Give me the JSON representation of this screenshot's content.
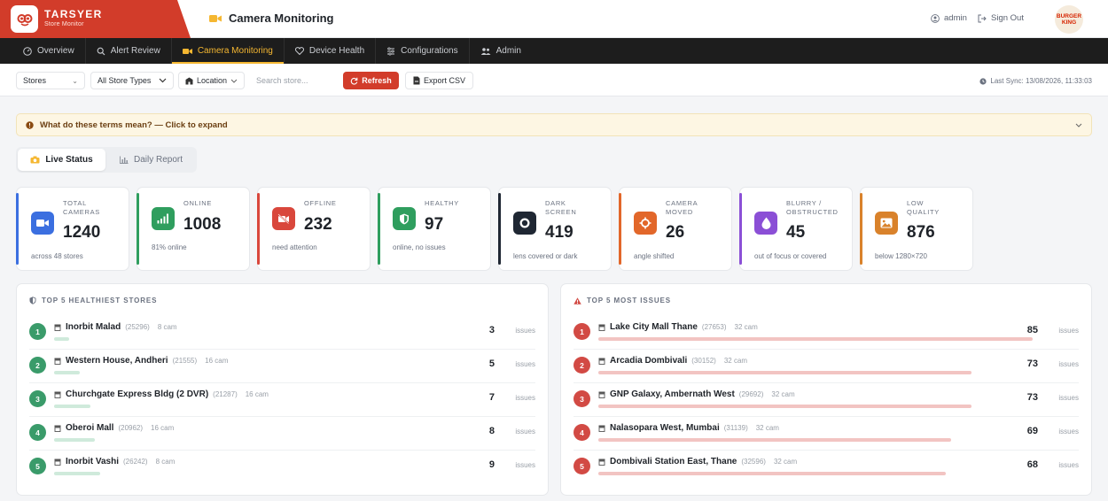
{
  "brand": {
    "name": "TARSYER",
    "subtitle": "Store Monitor"
  },
  "header": {
    "title": "Camera Monitoring",
    "user": "admin",
    "signout": "Sign Out",
    "partner_logo_line1": "BURGER",
    "partner_logo_line2": "KING"
  },
  "nav": [
    {
      "label": "Overview",
      "icon": "dashboard-icon"
    },
    {
      "label": "Alert Review",
      "icon": "search-icon"
    },
    {
      "label": "Camera Monitoring",
      "icon": "video-camera-icon",
      "active": true
    },
    {
      "label": "Device Health",
      "icon": "heart-icon"
    },
    {
      "label": "Configurations",
      "icon": "sliders-icon"
    },
    {
      "label": "Admin",
      "icon": "users-icon"
    }
  ],
  "filters": {
    "stores": "Stores",
    "store_types": "All Store Types",
    "location": "Location",
    "search_placeholder": "Search store...",
    "refresh": "Refresh",
    "export": "Export CSV",
    "last_sync": "Last Sync: 13/08/2026, 11:33:03"
  },
  "glossary": {
    "text": "What do these terms mean? — Click to expand"
  },
  "tabs": [
    {
      "label": "Live Status",
      "active": true
    },
    {
      "label": "Daily Report",
      "active": false
    }
  ],
  "stats": [
    {
      "label_line1": "TOTAL",
      "label_line2": "CAMERAS",
      "value": "1240",
      "sub": "across 48 stores",
      "color": "#3b6fe0",
      "icon": "video-camera-icon"
    },
    {
      "label_line1": "ONLINE",
      "label_line2": "",
      "value": "1008",
      "sub": "81% online",
      "color": "#2f9e5e",
      "icon": "signal-bars-icon"
    },
    {
      "label_line1": "OFFLINE",
      "label_line2": "",
      "value": "232",
      "sub": "need attention",
      "color": "#d9473c",
      "icon": "camera-off-icon"
    },
    {
      "label_line1": "HEALTHY",
      "label_line2": "",
      "value": "97",
      "sub": "online, no issues",
      "color": "#2f9e5e",
      "icon": "shield-icon"
    },
    {
      "label_line1": "DARK",
      "label_line2": "SCREEN",
      "value": "419",
      "sub": "lens covered or dark",
      "color": "#1f2733",
      "icon": "dark-circle-icon"
    },
    {
      "label_line1": "CAMERA",
      "label_line2": "MOVED",
      "value": "26",
      "sub": "angle shifted",
      "color": "#e2672a",
      "icon": "move-arrows-icon"
    },
    {
      "label_line1": "BLURRY /",
      "label_line2": "OBSTRUCTED",
      "value": "45",
      "sub": "out of focus or covered",
      "color": "#8b4fd6",
      "icon": "droplet-icon"
    },
    {
      "label_line1": "LOW",
      "label_line2": "QUALITY",
      "value": "876",
      "sub": "below 1280×720",
      "color": "#d9822b",
      "icon": "image-icon"
    }
  ],
  "healthiest": {
    "title": "TOP 5 HEALTHIEST STORES",
    "issues_label": "issues",
    "rows": [
      {
        "rank": "1",
        "name": "Inorbit Malad",
        "id": "(25296)",
        "cams": "8 cam",
        "issues": "3",
        "ratio": 0.3
      },
      {
        "rank": "2",
        "name": "Western House, Andheri",
        "id": "(21555)",
        "cams": "16 cam",
        "issues": "5",
        "ratio": 0.5
      },
      {
        "rank": "3",
        "name": "Churchgate Express Bldg (2 DVR)",
        "id": "(21287)",
        "cams": "16 cam",
        "issues": "7",
        "ratio": 0.7
      },
      {
        "rank": "4",
        "name": "Oberoi Mall",
        "id": "(20962)",
        "cams": "16 cam",
        "issues": "8",
        "ratio": 0.8
      },
      {
        "rank": "5",
        "name": "Inorbit Vashi",
        "id": "(26242)",
        "cams": "8 cam",
        "issues": "9",
        "ratio": 0.9
      }
    ]
  },
  "most_issues": {
    "title": "TOP 5 MOST ISSUES",
    "issues_label": "issues",
    "rows": [
      {
        "rank": "1",
        "name": "Lake City Mall Thane",
        "id": "(27653)",
        "cams": "32 cam",
        "issues": "85",
        "ratio": 1.0
      },
      {
        "rank": "2",
        "name": "Arcadia Dombivali",
        "id": "(30152)",
        "cams": "32 cam",
        "issues": "73",
        "ratio": 0.859
      },
      {
        "rank": "3",
        "name": "GNP Galaxy, Ambernath West",
        "id": "(29692)",
        "cams": "32 cam",
        "issues": "73",
        "ratio": 0.859
      },
      {
        "rank": "4",
        "name": "Nalasopara West, Mumbai",
        "id": "(31139)",
        "cams": "32 cam",
        "issues": "69",
        "ratio": 0.812
      },
      {
        "rank": "5",
        "name": "Dombivali Station East, Thane",
        "id": "(32596)",
        "cams": "32 cam",
        "issues": "68",
        "ratio": 0.8
      }
    ]
  },
  "colors": {
    "brand_red": "#d23c2a",
    "nav_active": "#f5b731",
    "healthy_green": "#3a9b6a",
    "issue_red": "#d24a44",
    "healthy_bar": "#cfeadb",
    "issue_bar": "#f2c4c2"
  }
}
